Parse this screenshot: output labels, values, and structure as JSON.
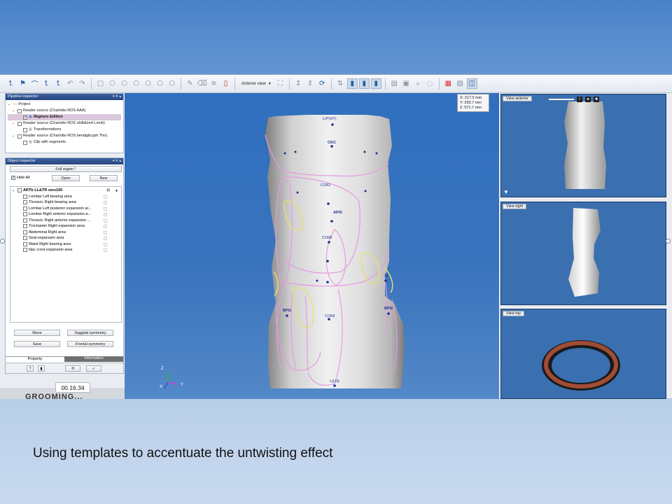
{
  "app": {
    "toolbar": {
      "view_mode_label": "Anterior view"
    },
    "pipeline_inspector": {
      "title": "Pipeline inspector",
      "items": [
        {
          "label": "Project"
        },
        {
          "label": "Reader source (Charlotte ROS AAA)"
        },
        {
          "label": "Regions Edition"
        },
        {
          "label": "Reader source (Charlotte ROS shift&lord Lomb)"
        },
        {
          "label": "Transformations"
        },
        {
          "label": "Reader source (Charlotte ROS bendg&cyph Tho)"
        },
        {
          "label": "Clip with segments"
        }
      ]
    },
    "object_inspector": {
      "title": "Object inspector",
      "region_select": "Full region *",
      "hide_all_label": "Hide All",
      "open_label": "Open",
      "new_label": "New",
      "group_label": "ARTb LL&TR vers100",
      "regions": [
        "Lombar Left bearing area",
        "Thoracic Right bearing area",
        "Lombar Left posterior expansion ar...",
        "Lombar Right anterior expansion a...",
        "Thoracic Right anterior expansion ...",
        "Trochanter Right expansion area",
        "Abdominal Right area",
        "Seat expansion area",
        "Waist Right bearing area",
        "Iliac crest expansion area"
      ],
      "move_label": "Move",
      "sagittal_label": "Saggital symmetry",
      "save_label": "Save",
      "frontal_label": "Frontal symmetry",
      "tab_property": "Property",
      "tab_information": "Information"
    },
    "coords": {
      "x": "X: 217.0 mm",
      "y": "Y: 293.7 mm",
      "z": "Z: 571.7 mm"
    },
    "right_views": {
      "anterior": "View anterior",
      "right": "View right",
      "top": "View top"
    },
    "landmarks": {
      "top": "L(P)HT)",
      "ckc": "CKC",
      "co62": "CO62",
      "apxi": "APXI",
      "co69": "CO69",
      "bpi1": "BPI1",
      "bpi2": "BPI2",
      "co68": "CO68",
      "ec11": "11",
      "bottom": "L(LN)"
    },
    "axes": {
      "z": "Z",
      "y": "Y",
      "x": "X"
    },
    "bottom_overlay": "GROOMING..."
  },
  "timer": "00.16.34",
  "caption": "Using templates to accentuate the untwisting effect",
  "colors": {
    "slide_blue": "#4a82c8",
    "viewport_blue": "#3973bd",
    "template_pink": "#e49be0",
    "template_yellow": "#e8e070",
    "landmark_blue": "#1e2f8a"
  }
}
